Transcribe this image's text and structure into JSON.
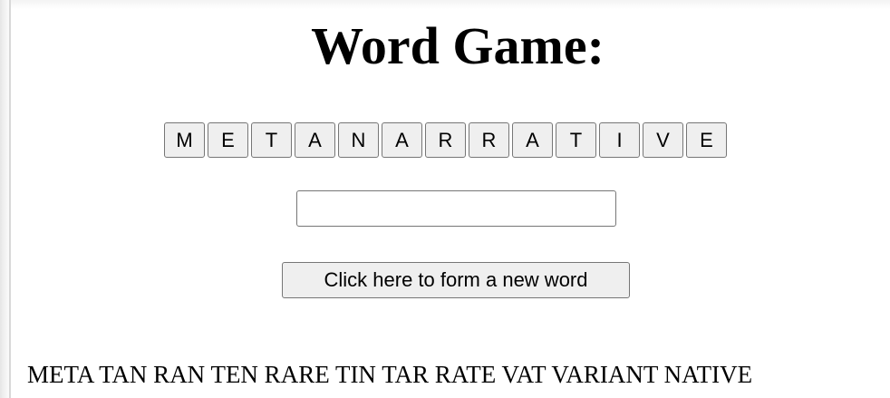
{
  "page": {
    "title": "Word Game:"
  },
  "letters": [
    "M",
    "E",
    "T",
    "A",
    "N",
    "A",
    "R",
    "R",
    "A",
    "T",
    "I",
    "V",
    "E"
  ],
  "input": {
    "value": "",
    "placeholder": ""
  },
  "form_button": {
    "label": "Click here to form a new word"
  },
  "found_words": {
    "text": "META TAN RAN TEN RARE TIN TAR RATE VAT VARIANT NATIVE"
  }
}
